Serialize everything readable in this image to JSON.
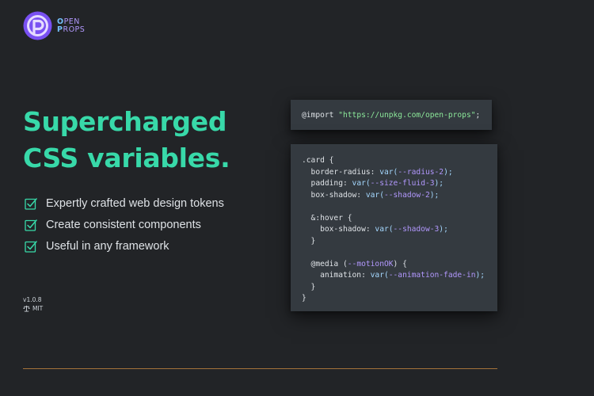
{
  "brand": {
    "logo_line1": "OPEN",
    "logo_line2": "PROPS"
  },
  "hero": {
    "headline_line1": "Supercharged",
    "headline_line2": "CSS variables."
  },
  "features": [
    {
      "label": "Expertly crafted web design tokens"
    },
    {
      "label": "Create consistent components"
    },
    {
      "label": "Useful in any framework"
    }
  ],
  "meta": {
    "version": "v1.0.8",
    "license": "MIT"
  },
  "code_import": {
    "keyword": "@import ",
    "url": "\"https://unpkg.com/open-props\"",
    "end": ";"
  },
  "code_card": {
    "l1": ".card {",
    "l2_prop": "  border-radius: ",
    "l2_fn": "var(",
    "l2_var": "--radius-2",
    "l2_end": ");",
    "l3_prop": "  padding: ",
    "l3_fn": "var(",
    "l3_var": "--size-fluid-3",
    "l3_end": ");",
    "l4_prop": "  box-shadow: ",
    "l4_fn": "var(",
    "l4_var": "--shadow-2",
    "l4_end": ");",
    "l6": "  &:hover {",
    "l7_prop": "    box-shadow: ",
    "l7_fn": "var(",
    "l7_var": "--shadow-3",
    "l7_end": ");",
    "l8": "  }",
    "l10_start": "  @media (",
    "l10_var": "--motionOK",
    "l10_end": ") {",
    "l11_prop": "    animation: ",
    "l11_fn": "var(",
    "l11_var": "--animation-fade-in",
    "l11_end": ");",
    "l12": "  }",
    "l13": "}"
  },
  "colors": {
    "background": "#222427",
    "accent_teal": "#38d9a9",
    "logo_violet": "#b197fc",
    "code_bg": "#343a40",
    "divider": "#a4723a"
  }
}
